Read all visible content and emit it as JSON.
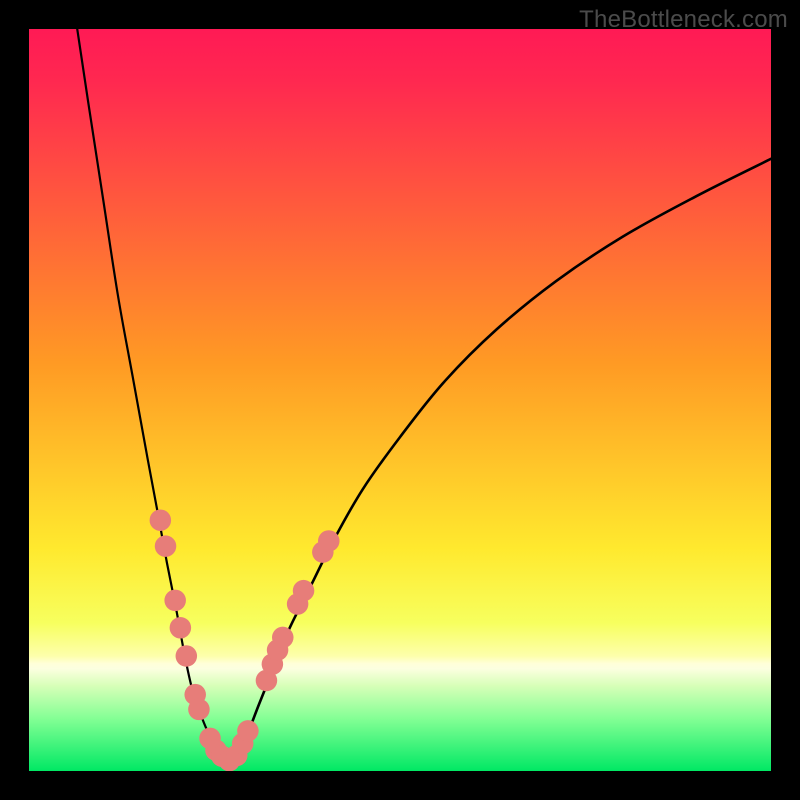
{
  "watermark": {
    "text": "TheBottleneck.com"
  },
  "chart_data": {
    "type": "line",
    "title": "",
    "xlabel": "",
    "ylabel": "",
    "xlim": [
      0,
      100
    ],
    "ylim": [
      0,
      100
    ],
    "gradient_stops": [
      {
        "offset": 0.0,
        "color": "#ff1a55"
      },
      {
        "offset": 0.07,
        "color": "#ff2850"
      },
      {
        "offset": 0.45,
        "color": "#ff9a24"
      },
      {
        "offset": 0.7,
        "color": "#ffe92e"
      },
      {
        "offset": 0.8,
        "color": "#f7ff5e"
      },
      {
        "offset": 0.845,
        "color": "#fdffab"
      },
      {
        "offset": 0.855,
        "color": "#ffffd8"
      },
      {
        "offset": 0.862,
        "color": "#fcffe0"
      },
      {
        "offset": 0.885,
        "color": "#d7ffb8"
      },
      {
        "offset": 0.93,
        "color": "#82ff94"
      },
      {
        "offset": 1.0,
        "color": "#00e864"
      }
    ],
    "series": [
      {
        "name": "left-branch",
        "x": [
          6.5,
          8,
          10,
          12,
          14,
          16,
          17.5,
          18.6,
          19.8,
          21,
          22,
          23,
          24,
          25,
          26,
          27
        ],
        "y": [
          100,
          90,
          77,
          64,
          53,
          42,
          34,
          28,
          22,
          15.5,
          11,
          8,
          5.5,
          3.7,
          2.2,
          1.2
        ]
      },
      {
        "name": "right-branch",
        "x": [
          27,
          28,
          29.5,
          31,
          33,
          35,
          38,
          41,
          45,
          50,
          56,
          63,
          71,
          80,
          90,
          100
        ],
        "y": [
          1.2,
          2.4,
          5.2,
          9,
          14,
          19,
          25,
          31,
          38,
          45,
          52.5,
          59.5,
          66,
          72,
          77.5,
          82.5
        ]
      }
    ],
    "scatter_points": {
      "color": "#e77d79",
      "radius_pct": 1.45,
      "points": [
        {
          "x": 17.7,
          "y": 33.8
        },
        {
          "x": 18.4,
          "y": 30.3
        },
        {
          "x": 19.7,
          "y": 23.0
        },
        {
          "x": 20.4,
          "y": 19.3
        },
        {
          "x": 21.2,
          "y": 15.5
        },
        {
          "x": 22.4,
          "y": 10.3
        },
        {
          "x": 22.9,
          "y": 8.3
        },
        {
          "x": 24.4,
          "y": 4.4
        },
        {
          "x": 25.2,
          "y": 2.8
        },
        {
          "x": 26.0,
          "y": 2.0
        },
        {
          "x": 27.0,
          "y": 1.4
        },
        {
          "x": 28.0,
          "y": 2.1
        },
        {
          "x": 28.8,
          "y": 3.7
        },
        {
          "x": 29.5,
          "y": 5.4
        },
        {
          "x": 32.0,
          "y": 12.2
        },
        {
          "x": 32.8,
          "y": 14.4
        },
        {
          "x": 33.5,
          "y": 16.3
        },
        {
          "x": 34.2,
          "y": 18.0
        },
        {
          "x": 36.2,
          "y": 22.5
        },
        {
          "x": 37.0,
          "y": 24.3
        },
        {
          "x": 39.6,
          "y": 29.5
        },
        {
          "x": 40.4,
          "y": 31.0
        }
      ]
    }
  }
}
